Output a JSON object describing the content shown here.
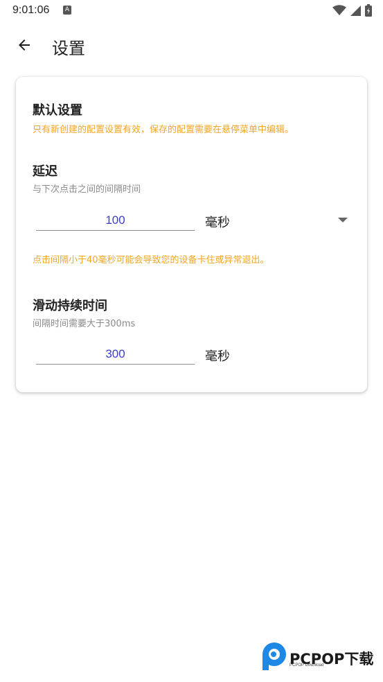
{
  "status_bar": {
    "time": "9:01:06",
    "notification_icon": "a-letter-icon",
    "icons": [
      "wifi-icon",
      "signal-icon",
      "battery-icon"
    ]
  },
  "app_bar": {
    "back_icon": "arrow-left-icon",
    "title": "设置"
  },
  "card": {
    "default_section": {
      "title": "默认设置",
      "note": "只有新创建的配置设置有效，保存的配置需要在悬停菜单中编辑。"
    },
    "delay_section": {
      "title": "延迟",
      "subtitle": "与下次点击之间的间隔时间",
      "value": "100",
      "unit": "毫秒",
      "dropdown_icon": "triangle-down-icon",
      "warning": "点击间隔小于40毫秒可能会导致您的设备卡住或异常退出。"
    },
    "swipe_section": {
      "title": "滑动持续时间",
      "subtitle": "间隔时间需要大于300ms",
      "value": "300",
      "unit": "毫秒"
    }
  },
  "watermark": {
    "text": "PCPOP下载",
    "subtext": "PCPOP Download"
  },
  "colors": {
    "accent_value": "#3a3fd0",
    "warning": "#f5a524",
    "watermark_blue": "#1e88e5"
  }
}
